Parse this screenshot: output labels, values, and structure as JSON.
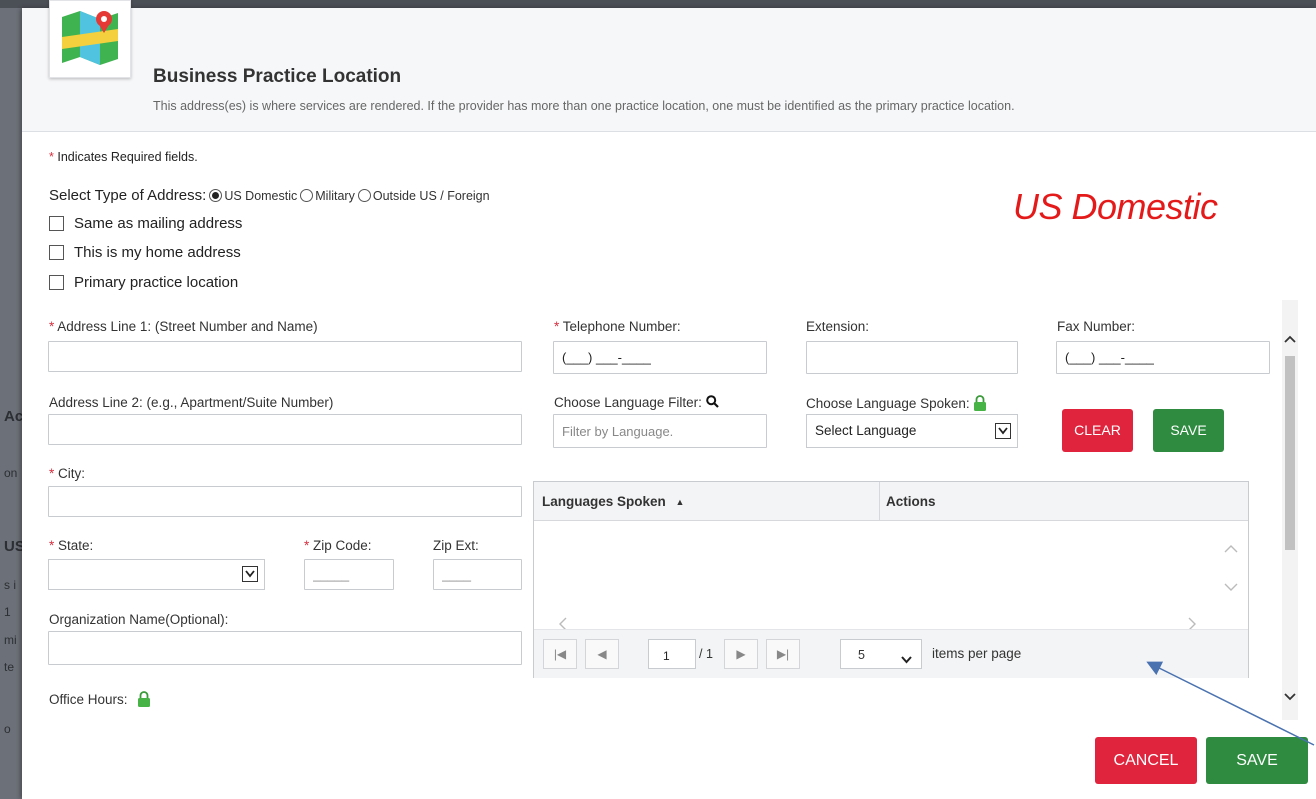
{
  "background_fragments": [
    "Ac",
    "on",
    "US",
    "s i",
    "1",
    "mi",
    "te",
    "o"
  ],
  "modal": {
    "title": "Business Practice Location",
    "subtitle": "This address(es) is where services are rendered. If the provider has more than one practice location, one must be identified as the primary practice location."
  },
  "required_note": {
    "asterisk": "*",
    "text": " Indicates Required fields."
  },
  "address_type": {
    "label": "Select Type of Address:",
    "options": [
      "US Domestic",
      "Military",
      "Outside US / Foreign"
    ],
    "selected": "US Domestic"
  },
  "checkboxes": [
    "Same as mailing address",
    "This is my home address",
    "Primary practice location"
  ],
  "annotation": {
    "text": "US Domestic",
    "color": "#e41a1a"
  },
  "fields": {
    "address1_label": "Address Line 1: (Street Number and Name)",
    "address2_label": "Address Line 2: (e.g., Apartment/Suite Number)",
    "city_label": "City:",
    "state_label": "State:",
    "zip_label": "Zip Code:",
    "zip_ext_label": "Zip Ext:",
    "org_label": "Organization Name(Optional):",
    "office_hours_label": "Office Hours:",
    "telephone_label": "Telephone Number:",
    "telephone_mask": "(___) ___-____",
    "extension_label": "Extension:",
    "fax_label": "Fax Number:",
    "fax_mask": "(___) ___-____",
    "language_filter_label": "Choose Language Filter:",
    "language_filter_placeholder": "Filter by Language.",
    "language_spoken_label": "Choose Language Spoken:",
    "language_select_value": "Select Language",
    "zip_placeholder": "_____",
    "zip_ext_placeholder": "____"
  },
  "buttons": {
    "clear": "CLEAR",
    "save_language": "SAVE",
    "cancel": "CANCEL",
    "save": "SAVE"
  },
  "grid": {
    "columns": [
      "Languages Spoken",
      "Actions"
    ],
    "sort_indicator": "▲",
    "pager": {
      "page": "1",
      "total": "/ 1",
      "page_size": "5",
      "items_label": "items per page"
    }
  },
  "colors": {
    "red_button": "#e0243d",
    "green_button": "#2e8b3f",
    "required_asterisk": "#d62f3f",
    "annotation_arrow": "#4a72b0"
  }
}
